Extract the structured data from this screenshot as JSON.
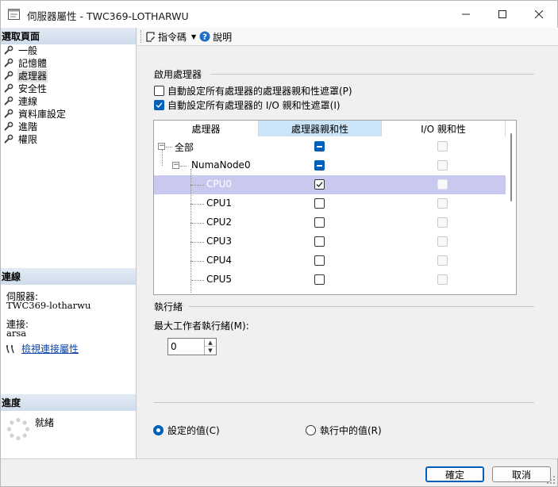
{
  "window": {
    "title": "伺服器屬性 - TWC369-LOTHARWU"
  },
  "left_pane": {
    "select_page_header": "選取頁面",
    "pages": [
      {
        "label": "一般"
      },
      {
        "label": "記憶體"
      },
      {
        "label": "處理器",
        "selected": true
      },
      {
        "label": "安全性"
      },
      {
        "label": "連線"
      },
      {
        "label": "資料庫設定"
      },
      {
        "label": "進階"
      },
      {
        "label": "權限"
      }
    ],
    "connection_header": "連線",
    "server_label": "伺服器:",
    "server_value": "TWC369-lotharwu",
    "connection_label": "連接:",
    "connection_value": "arsa",
    "view_connection_link": "檢視連接屬性",
    "progress_header": "進度",
    "progress_status": "就緒"
  },
  "toolbar": {
    "script_label": "指令碼",
    "help_label": "說明"
  },
  "processor": {
    "enable_group_title": "啟用處理器",
    "auto_affinity_label": "自動設定所有處理器的處理器親和性遮罩(P)",
    "auto_affinity_checked": false,
    "auto_io_affinity_label": "自動設定所有處理器的 I/O 親和性遮罩(I)",
    "auto_io_affinity_checked": true,
    "grid": {
      "columns": [
        "處理器",
        "處理器親和性",
        "I/O 親和性"
      ],
      "rows": [
        {
          "label": "全部",
          "level": 0,
          "toggle": "−",
          "affinity": "indeterminate",
          "io": "disabled"
        },
        {
          "label": "NumaNode0",
          "level": 1,
          "toggle": "−",
          "affinity": "indeterminate",
          "io": "disabled"
        },
        {
          "label": "CPU0",
          "level": 2,
          "affinity": "checked",
          "io": "disabled",
          "selected": true
        },
        {
          "label": "CPU1",
          "level": 2,
          "affinity": "unchecked",
          "io": "disabled"
        },
        {
          "label": "CPU2",
          "level": 2,
          "affinity": "unchecked",
          "io": "disabled"
        },
        {
          "label": "CPU3",
          "level": 2,
          "affinity": "unchecked",
          "io": "disabled"
        },
        {
          "label": "CPU4",
          "level": 2,
          "affinity": "unchecked",
          "io": "disabled"
        },
        {
          "label": "CPU5",
          "level": 2,
          "affinity": "unchecked",
          "io": "disabled"
        }
      ]
    },
    "threads_group_title": "執行緒",
    "max_worker_threads_label": "最大工作者執行緒(M):",
    "max_worker_threads_value": "0",
    "configured_values_label": "設定的值(C)",
    "running_values_label": "執行中的值(R)",
    "selected_mode": "configured"
  },
  "footer": {
    "ok_label": "確定",
    "cancel_label": "取消"
  },
  "colors": {
    "accent": "#005fb8",
    "selection_row": "#c9c8ee",
    "header_active": "#cce4f7",
    "link": "#0645ad"
  }
}
